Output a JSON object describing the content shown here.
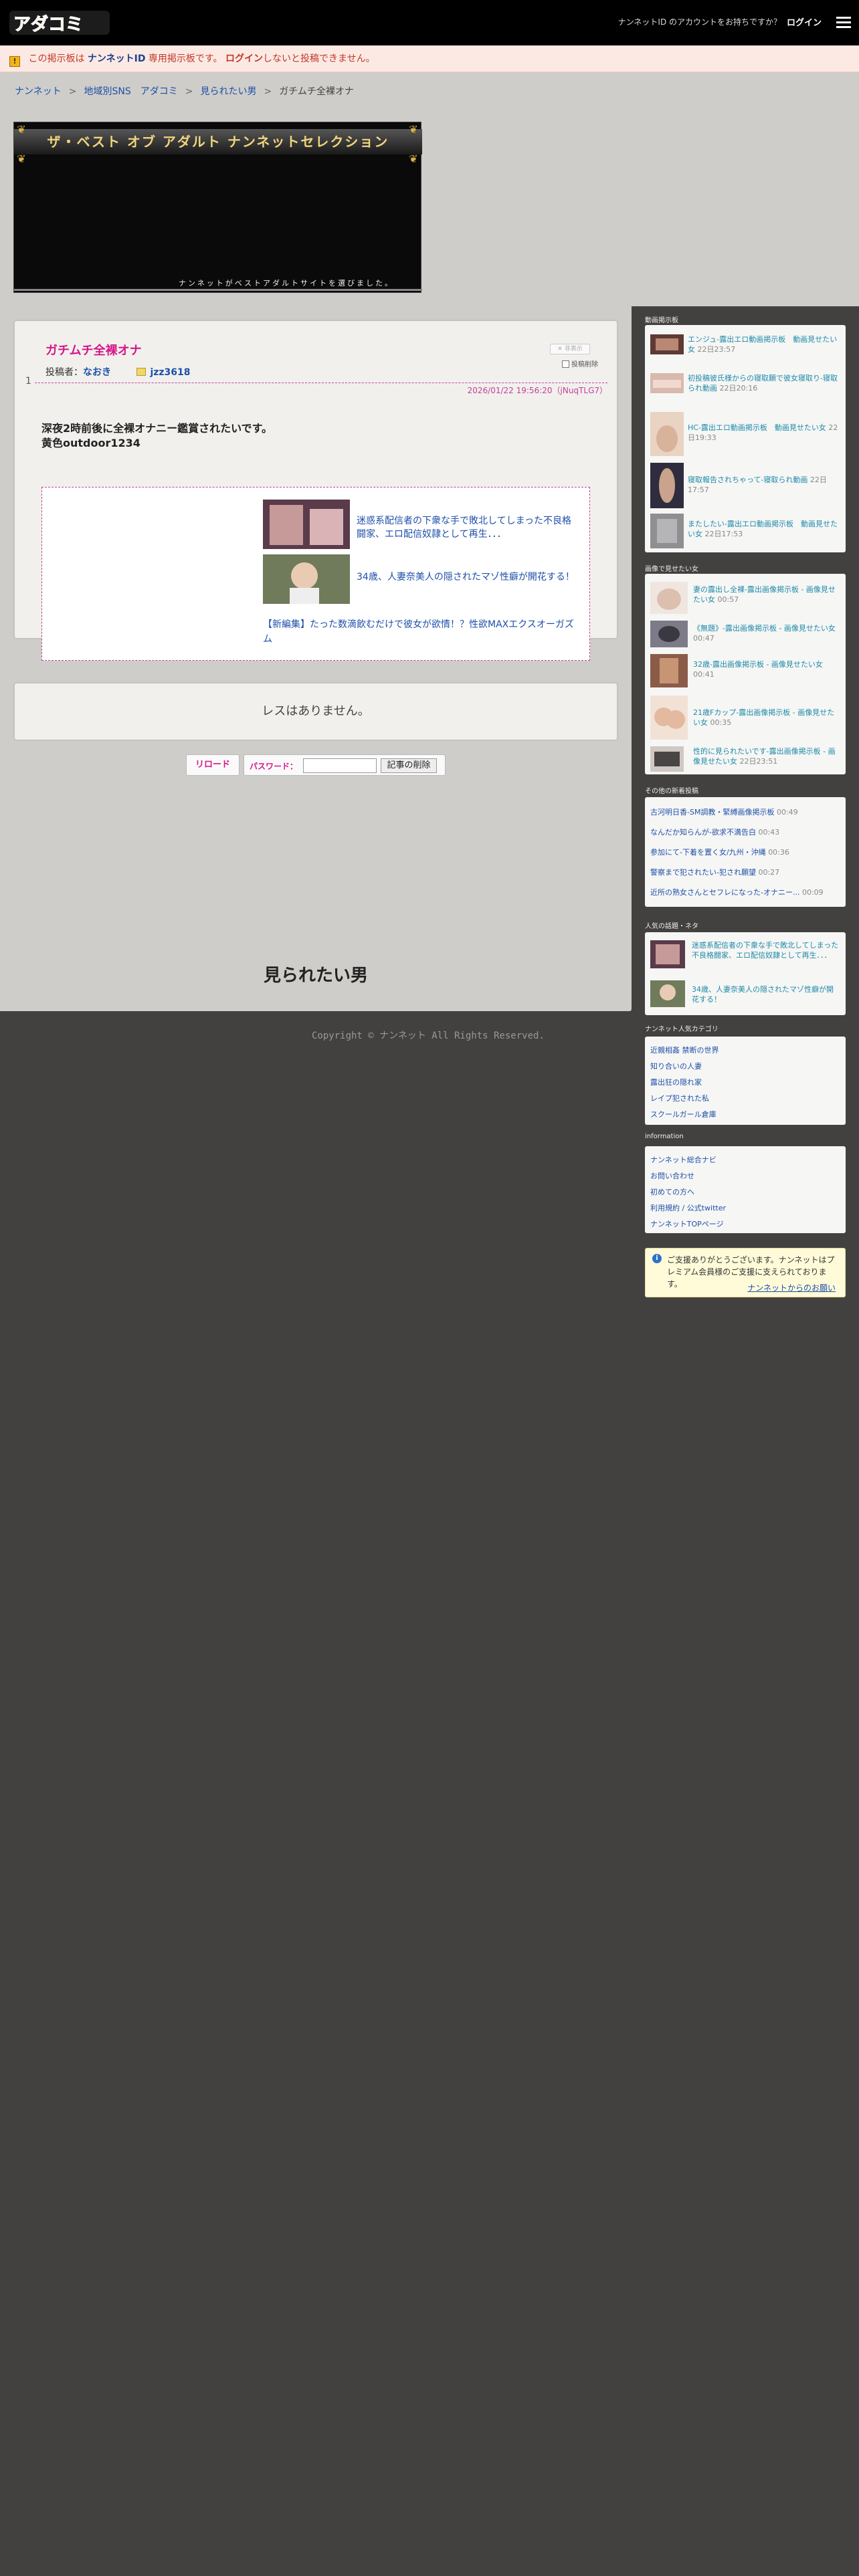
{
  "header": {
    "logo_text": "アダコミ",
    "account_question": "ナンネットID のアカウントをお持ちですか？",
    "login": "ログイン"
  },
  "notice": {
    "icon": "!",
    "part1": "この掲示板は",
    "brand": "ナンネットID",
    "part2": "専用掲示板です。",
    "login": "ログイン",
    "part3": "しないと投稿できません。"
  },
  "breadcrumb": [
    {
      "label": "ナンネット"
    },
    {
      "label": "地域別SNS　アダコミ"
    },
    {
      "label": "見られたい男"
    },
    {
      "label": "ガチムチ全裸オナ"
    }
  ],
  "banner": {
    "title": "ザ・ベスト オブ アダルト ナンネットセレクション",
    "caption": "ナンネットがベストアダルトサイトを選びました。"
  },
  "thread": {
    "number": "1",
    "title": "ガチムチ全裸オナ",
    "hide_button": "非表示",
    "delete_checkbox": "投稿削除",
    "poster_label": "投稿者：",
    "poster_name": "なおき",
    "user_id": "jzz3618",
    "date": "2026/01/22 19:56:20（jNuqTLG7）",
    "body_line1": "深夜2時前後に全裸オナニー鑑賞されたいです。",
    "body_line2": "黄色outdoor1234"
  },
  "ads": {
    "item1": "迷惑系配信者の下衆な手で敗北してしまった不良格闘家、エロ配信奴隷として再生．．．",
    "item2": "34歳、人妻奈美人の隠されたマゾ性癖が開花する！",
    "new": "【新編集】たった数滴飲むだけで彼女が欲情！？性欲MAXエクスオーガズム"
  },
  "no_res": "レスはありません。",
  "controls": {
    "reload": "リロード",
    "password_label": "パスワード：",
    "delete_button": "記事の削除"
  },
  "bottom_title": "見られたい男",
  "copyright": "Copyright © ナンネット All Rights Reserved.",
  "sidebar": {
    "sec1_title": "動画掲示板",
    "sec1_items": [
      {
        "text": "エンジュ-露出エロ動画掲示板　動画見せたい女",
        "time": "22日23:57"
      },
      {
        "text": "初投稿彼氏様からの寝取願で彼女寝取り-寝取られ動画",
        "time": "22日20:16"
      },
      {
        "text": "HC-露出エロ動画掲示板　動画見せたい女",
        "time": "22日19:33"
      },
      {
        "text": "寝取報告されちゃって-寝取られ動画",
        "time": "22日17:57"
      },
      {
        "text": "またしたい-露出エロ動画掲示板　動画見せたい女",
        "time": "22日17:53"
      }
    ],
    "sec2_title": "画像で見せたい女",
    "sec2_items": [
      {
        "text": "妻の露出し全裸-露出画像掲示板 - 画像見せたい女",
        "time": "00:57"
      },
      {
        "text": "《無題》-露出画像掲示板 - 画像見せたい女",
        "time": "00:47"
      },
      {
        "text": "32歳-露出画像掲示板 - 画像見せたい女",
        "time": "00:41"
      },
      {
        "text": "21歳Fカップ-露出画像掲示板 - 画像見せたい女",
        "time": "00:35"
      },
      {
        "text": "性的に見られたいです-露出画像掲示板 - 画像見せたい女",
        "time": "22日23:51"
      }
    ],
    "sec3_title": "その他の新着投稿",
    "sec3_items": [
      {
        "text": "古河明日香-SM調教・緊縛画像掲示板",
        "time": "00:49"
      },
      {
        "text": "なんだか知らんが-欲求不満告白",
        "time": "00:43"
      },
      {
        "text": "参加にて-下着を置く女/九州・沖縄",
        "time": "00:36"
      },
      {
        "text": "警察まで犯されたい-犯され願望",
        "time": "00:27"
      },
      {
        "text": "近所の熟女さんとセフレになった-オナニー...",
        "time": "00:09"
      }
    ],
    "sec4_title": "人気の話題・ネタ",
    "sec4_items": [
      {
        "text": "迷惑系配信者の下衆な手で敗北してしまった不良格闘家、エロ配信奴隷として再生．．．"
      },
      {
        "text": "34歳、人妻奈美人の隠されたマゾ性癖が開花する！"
      }
    ],
    "sec5_title": "ナンネット人気カテゴリ",
    "sec5_items": [
      "近親相姦 禁断の世界",
      "知り合いの人妻",
      "露出狂の隠れ家",
      "レイプ犯された私",
      "スクールガール倉庫"
    ],
    "sec6_title": "information",
    "sec6_items": [
      "ナンネット総合ナビ",
      "お問い合わせ",
      "初めての方へ",
      "利用規約 / 公式twitter",
      "ナンネットTOPページ"
    ],
    "thanks_icon": "i",
    "thanks_text": "ご支援ありがとうございます。ナンネットはプレミアム会員様のご支援に支えられております。",
    "thanks_link": "ナンネットからのお願い"
  }
}
